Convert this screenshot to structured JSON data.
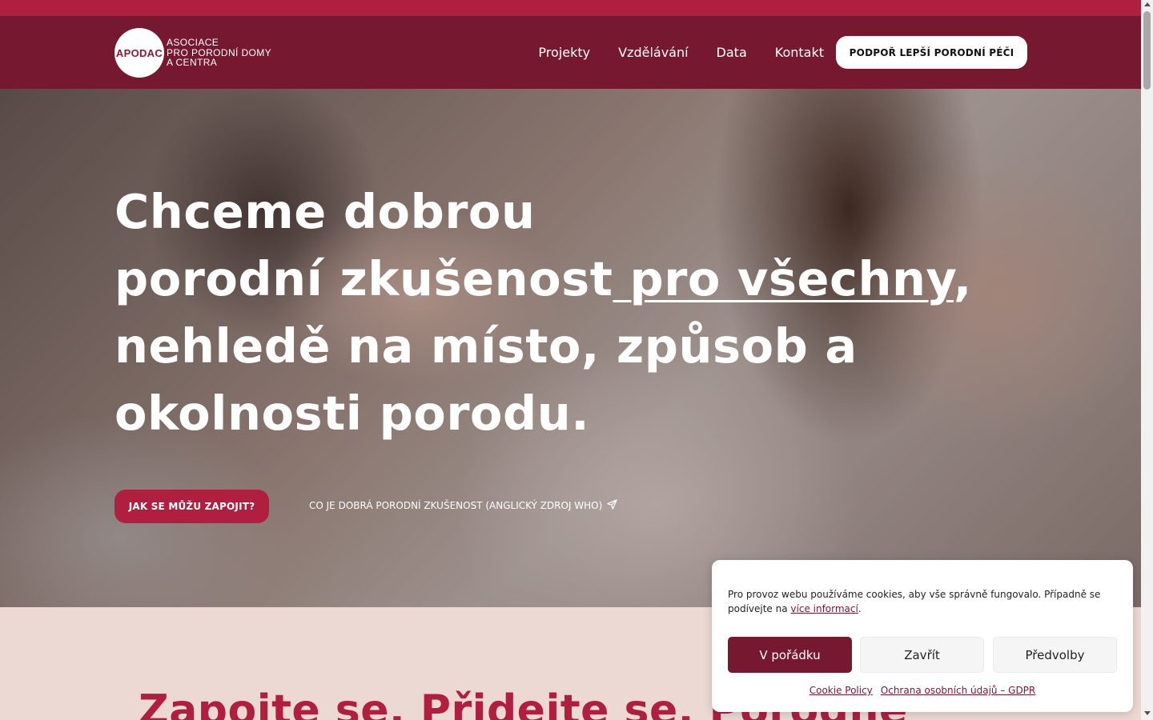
{
  "header": {
    "logo_mark": "APODAC",
    "logo_lines": [
      "ASOCIACE",
      "PRO PORODNÍ DOMY",
      "A CENTRA"
    ],
    "nav": [
      "Projekty",
      "Vzdělávání",
      "Data",
      "Kontakt"
    ],
    "cta": "PODPOŘ LEPŠÍ PORODNÍ PÉČI"
  },
  "hero": {
    "line1": "Chceme dobrou",
    "line2_a": "porodní zkušenost",
    "line2_link": " pro všechny",
    "line2_b": ",",
    "line3": "nehledě na místo, způsob a",
    "line4": "okolnosti porodu.",
    "primary_button": "JAK SE MŮŽU ZAPOJIT?",
    "secondary_link": "CO JE DOBRÁ PORODNÍ ZKUŠENOST (ANGLICKÝ ZDROJ WHO)",
    "secondary_icon": "send-icon"
  },
  "section2": {
    "title": "Zapojte se. Přidejte se. Porodne"
  },
  "cookie": {
    "text": "Pro provoz webu používáme cookies, aby vše správně fungovalo. Případně se podívejte na ",
    "more_link": "více informací",
    "text_end": ".",
    "accept": "V pořádku",
    "close": "Zavřít",
    "prefs": "Předvolby",
    "links": [
      "Cookie Policy",
      "Ochrana osobních údajů – GDPR"
    ]
  },
  "colors": {
    "brand_dark": "#751830",
    "brand": "#b01f3f",
    "section_bg": "#ecd9d4"
  }
}
